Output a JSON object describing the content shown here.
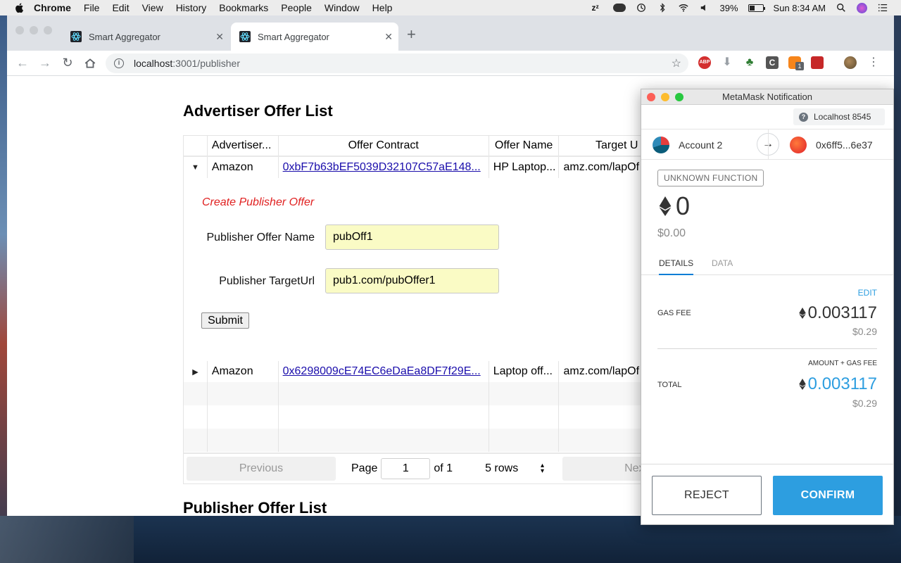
{
  "menubar": {
    "app": "Chrome",
    "items": [
      "File",
      "Edit",
      "View",
      "History",
      "Bookmarks",
      "People",
      "Window",
      "Help"
    ],
    "battery": "39%",
    "clock": "Sun 8:34 AM"
  },
  "browser": {
    "tabs": [
      {
        "title": "Smart Aggregator"
      },
      {
        "title": "Smart Aggregator"
      }
    ],
    "url_host": "localhost",
    "url_rest": ":3001/publisher",
    "ext_badge": "1"
  },
  "page": {
    "advertiser_heading": "Advertiser Offer List",
    "publisher_heading": "Publisher Offer List",
    "columns": [
      "Advertiser...",
      "Offer Contract",
      "Offer Name",
      "Target U"
    ],
    "rows": [
      {
        "advertiser": "Amazon",
        "contract": "0xbF7b63bEF5039D32107C57aE148...",
        "name": "HP Laptop...",
        "target": "amz.com/lapOf"
      },
      {
        "advertiser": "Amazon",
        "contract": "0x6298009cE74EC6eDaEa8DF7f29E...",
        "name": "Laptop off...",
        "target": "amz.com/lapOf"
      }
    ],
    "form": {
      "title": "Create Publisher Offer",
      "name_label": "Publisher Offer Name",
      "name_value": "pubOff1",
      "url_label": "Publisher TargetUrl",
      "url_value": "pub1.com/pubOffer1",
      "submit": "Submit"
    },
    "pager": {
      "previous": "Previous",
      "page_label": "Page",
      "page_value": "1",
      "of_label": "of 1",
      "rows_select": "5 rows",
      "next": "Nex"
    }
  },
  "metamask": {
    "window_title": "MetaMask Notification",
    "network": "Localhost 8545",
    "from_account": "Account 2",
    "to_address": "0x6ff5...6e37",
    "function_badge": "UNKNOWN FUNCTION",
    "amount_eth": "0",
    "amount_usd": "$0.00",
    "tab_details": "DETAILS",
    "tab_data": "DATA",
    "edit": "EDIT",
    "gas_fee_label": "GAS FEE",
    "gas_fee_eth": "0.003117",
    "gas_fee_usd": "$0.29",
    "amount_plus_gas": "AMOUNT + GAS FEE",
    "total_label": "TOTAL",
    "total_eth": "0.003117",
    "total_usd": "$0.29",
    "reject": "REJECT",
    "confirm": "CONFIRM",
    "accent": "#2d9ee0"
  }
}
